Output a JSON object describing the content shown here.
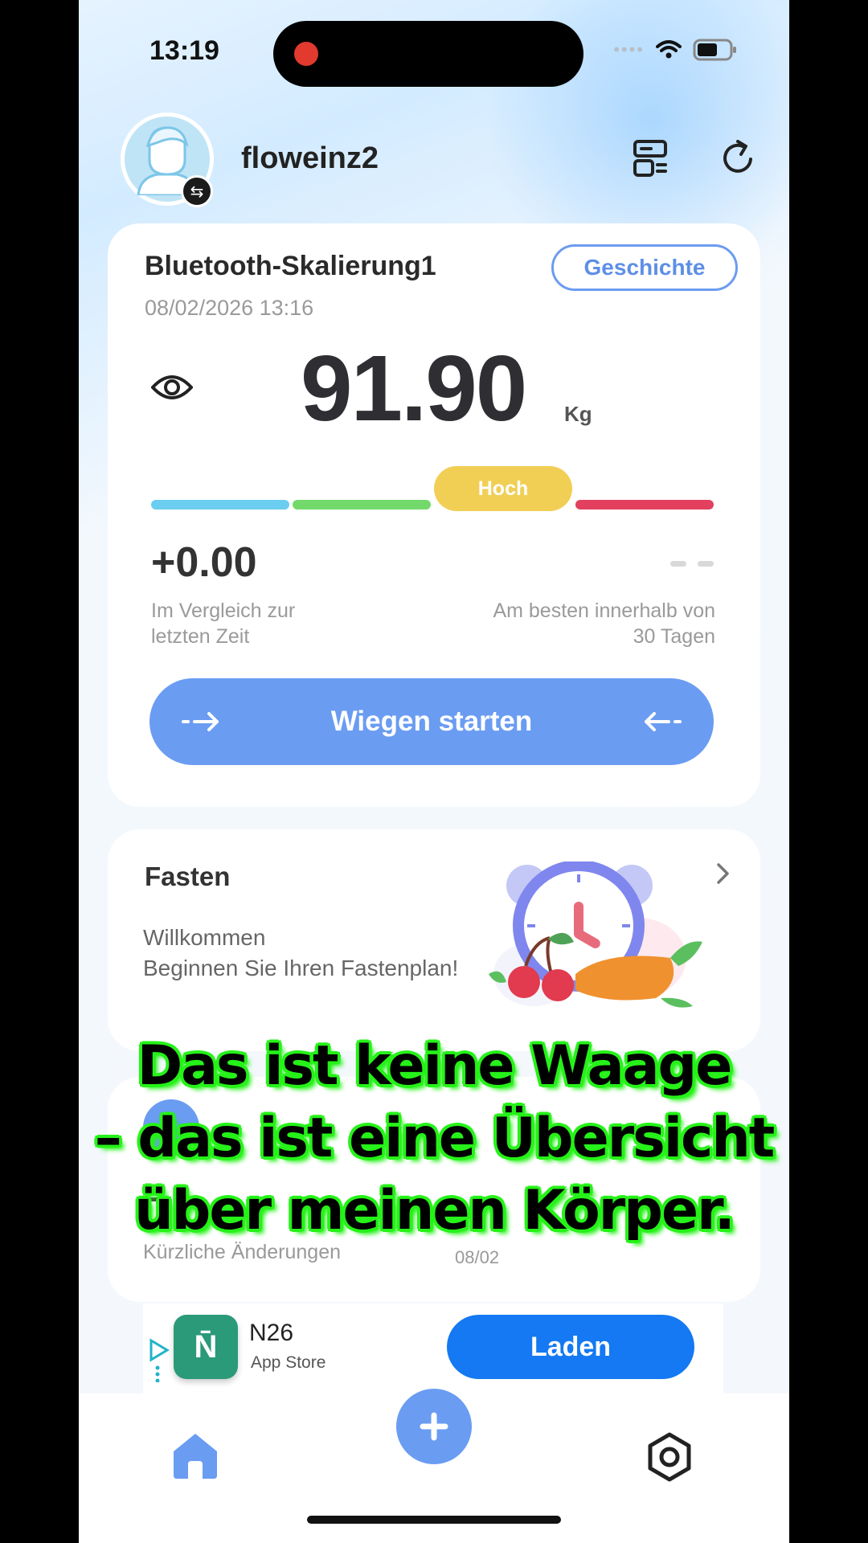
{
  "status": {
    "time": "13:19"
  },
  "header": {
    "username": "floweinz2"
  },
  "scale": {
    "device_name": "Bluetooth-Skalierung1",
    "date": "08/02/2026 13:16",
    "history_label": "Geschichte",
    "weight": "91.90",
    "unit": "Kg",
    "category": "Hoch",
    "bar_colors": [
      "#6bcdef",
      "#73d96b",
      "#f1cf55",
      "#e2405e"
    ],
    "delta": "+0.00",
    "compare_left": "Im Vergleich zur\nletzten Zeit",
    "compare_right": "Am besten innerhalb von\n30 Tagen",
    "start_label": "Wiegen starten"
  },
  "fasting": {
    "title": "Fasten",
    "line1": "Willkommen",
    "line2": "Beginnen Sie Ihren Fastenplan!"
  },
  "recent": {
    "label": "Kürzliche Änderungen",
    "date": "08/02"
  },
  "ad": {
    "title": "N26",
    "subtitle": "App Store",
    "button": "Laden",
    "logo_text": "N̄"
  },
  "caption": {
    "line1": "Das ist keine Waage",
    "line2": "– das ist eine Übersicht",
    "line3": "über meinen Körper."
  },
  "colors": {
    "accent": "#6a9cf2",
    "ad_button": "#1479f2",
    "caption_outline": "#27f21a"
  },
  "icons": [
    "profile-avatar",
    "swap-icon",
    "device-manage-icon",
    "refresh-icon",
    "eye-icon",
    "chevron-right-icon",
    "ad-play-icon",
    "home-icon",
    "plus-icon",
    "settings-icon"
  ]
}
